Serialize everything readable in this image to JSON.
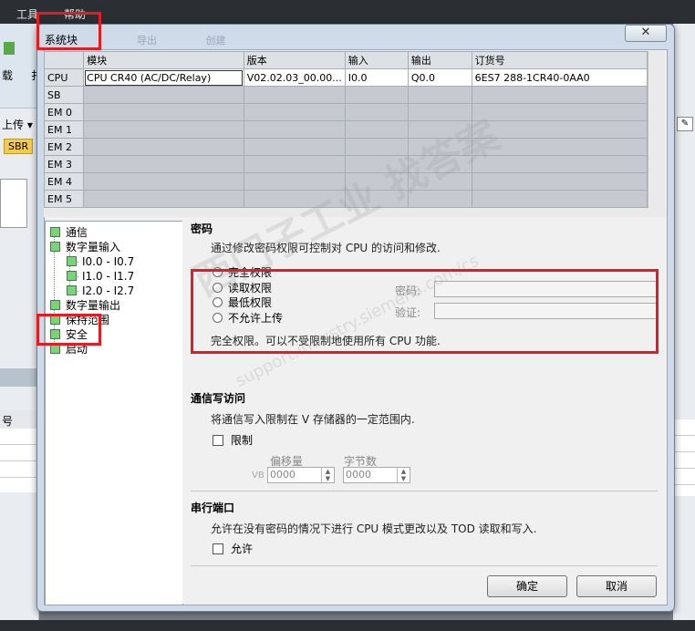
{
  "app": {
    "menu": [
      "工具",
      "帮助"
    ],
    "toolbar_ghost": [
      "导出",
      "创建"
    ],
    "left_fragments": {
      "toolbar_a": "载",
      "toolbar_b": "扌",
      "upload": "上传 ▾",
      "sbr_tab": "SBR",
      "table_header": "号"
    }
  },
  "dialog": {
    "title": "系统块",
    "close_glyph": "✕",
    "module_table": {
      "headers": [
        "",
        "模块",
        "版本",
        "输入",
        "输出",
        "订货号"
      ],
      "rows": [
        [
          "CPU",
          "CPU CR40 (AC/DC/Relay)",
          "V02.02.03_00.00...",
          "I0.0",
          "Q0.0",
          "6ES7 288-1CR40-0AA0"
        ],
        [
          "SB",
          "",
          "",
          "",
          "",
          ""
        ],
        [
          "EM 0",
          "",
          "",
          "",
          "",
          ""
        ],
        [
          "EM 1",
          "",
          "",
          "",
          "",
          ""
        ],
        [
          "EM 2",
          "",
          "",
          "",
          "",
          ""
        ],
        [
          "EM 3",
          "",
          "",
          "",
          "",
          ""
        ],
        [
          "EM 4",
          "",
          "",
          "",
          "",
          ""
        ],
        [
          "EM 5",
          "",
          "",
          "",
          "",
          ""
        ]
      ]
    },
    "tree": {
      "items": [
        {
          "label": "通信"
        },
        {
          "label": "数字量输入"
        },
        {
          "label": "I0.0 - I0.7"
        },
        {
          "label": "I1.0 - I1.7"
        },
        {
          "label": "I2.0 - I2.7"
        },
        {
          "label": "数字量输出"
        },
        {
          "label": "保持范围"
        },
        {
          "label": "安全"
        },
        {
          "label": "启动"
        }
      ]
    },
    "password": {
      "title": "密码",
      "description": "通过修改密码权限可控制对 CPU 的访问和修改.",
      "options": [
        "完全权限",
        "读取权限",
        "最低权限",
        "不允许上传"
      ],
      "password_label": "密码:",
      "verify_label": "验证:",
      "note": "完全权限。可以不受限制地使用所有 CPU 功能."
    },
    "comm_write": {
      "title": "通信写访问",
      "description": "将通信写入限制在 V 存储器的一定范围内.",
      "restrict_label": "限制",
      "offset_label": "偏移量",
      "bytes_label": "字节数",
      "vb_prefix": "VB",
      "offset_value": "0000",
      "bytes_value": "0000"
    },
    "serial": {
      "title": "串行端口",
      "description": "允许在没有密码的情况下进行 CPU 模式更改以及 TOD 读取和写入.",
      "allow_label": "允许"
    },
    "buttons": {
      "ok": "确定",
      "cancel": "取消"
    }
  },
  "watermark": {
    "line1": "西门子工业 找答案",
    "line2": "support.industry.siemens.com/cs"
  },
  "colors": {
    "highlight": "#e31b23",
    "tree_checkbox": "#7ad27a",
    "dialog_frame": "#cfdbe9"
  }
}
